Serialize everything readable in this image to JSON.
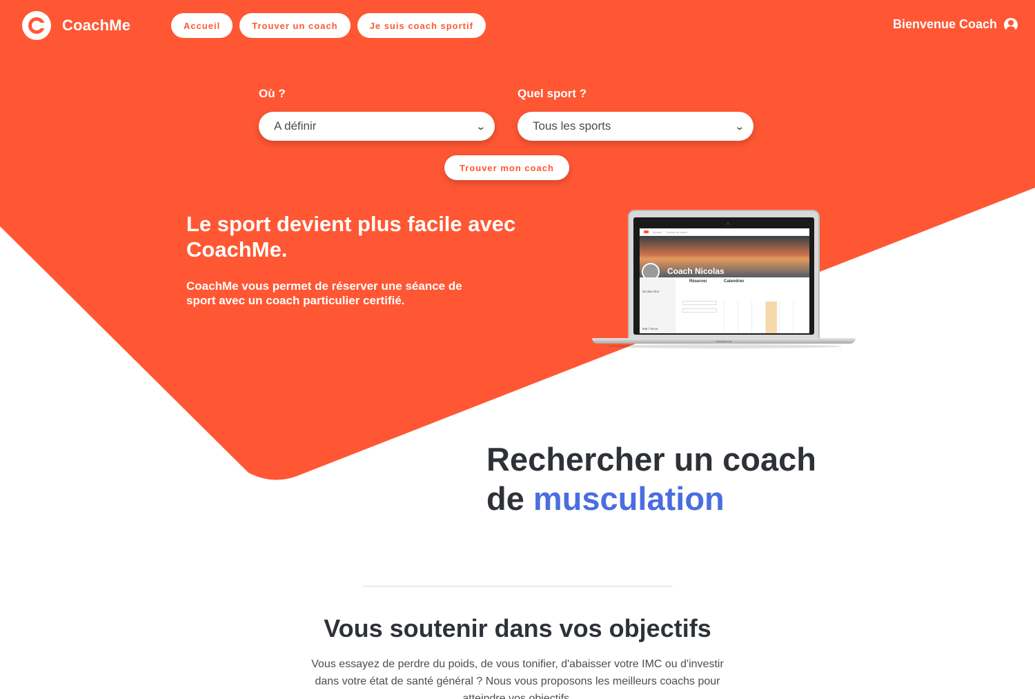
{
  "colors": {
    "brand": "#ff5733",
    "accent": "#4a6ee0",
    "text_dark": "#2e3238",
    "white": "#ffffff"
  },
  "brand": {
    "name": "CoachMe",
    "icon": "coachme-logo-icon"
  },
  "nav": {
    "items": [
      {
        "label": "Accueil"
      },
      {
        "label": "Trouver un coach"
      },
      {
        "label": "Je suis coach sportif"
      }
    ],
    "welcome": "Bienvenue Coach",
    "user_icon": "user-circle-icon"
  },
  "search": {
    "where": {
      "label": "Où ?",
      "value": "A définir"
    },
    "sport": {
      "label": "Quel sport ?",
      "value": "Tous les sports"
    },
    "submit": "Trouver mon coach"
  },
  "hero": {
    "title": "Le sport devient plus facile avec CoachMe.",
    "subtitle": "CoachMe vous permet de réserver une séance de sport avec un coach particulier certifié."
  },
  "laptop_mockup": {
    "coach_name": "Coach Nicolas",
    "tab_reserve": "Réserver",
    "tab_calendar": "Calendrier",
    "profile_name": "Nicolas Diot",
    "price": "50€ / heure",
    "device_label": "MacBook Air"
  },
  "section": {
    "title_prefix": "Rechercher un coach",
    "title_de": "de",
    "title_accent": "musculation"
  },
  "objectives": {
    "title": "Vous soutenir dans vos objectifs",
    "text": "Vous essayez de perdre du poids, de vous tonifier, d'abaisser votre IMC ou d'investir dans votre état de santé général ? Nous vous proposons les meilleurs coachs pour atteindre vos objectifs."
  }
}
